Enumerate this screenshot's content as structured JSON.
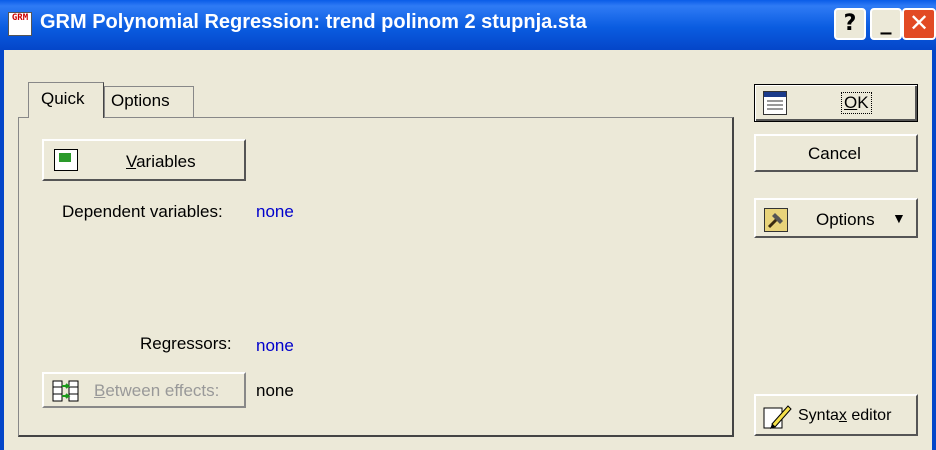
{
  "window": {
    "title": "GRM Polynomial Regression: trend polinom 2 stupnja.sta",
    "app_icon_text": "GRM",
    "help_glyph": "?",
    "minimize_glyph": "_",
    "close_glyph": "✕"
  },
  "tabs": [
    {
      "label": "Quick",
      "active": true
    },
    {
      "label": "Options",
      "active": false
    }
  ],
  "quick": {
    "variables_button": {
      "mnemonic": "V",
      "rest": "ariables"
    },
    "dependent_label": "Dependent variables:",
    "dependent_value": "none",
    "regressors_label": "Regressors:",
    "regressors_value": "none",
    "between_button": {
      "mnemonic": "B",
      "rest": "etween effects:",
      "enabled": false
    },
    "between_value": "none"
  },
  "side_buttons": {
    "ok": {
      "mnemonic": "O",
      "rest": "K"
    },
    "cancel": "Cancel",
    "options": "Options",
    "options_arrow": "▼",
    "syntax": {
      "before": "Synta",
      "mnemonic": "x",
      "after": " editor"
    }
  },
  "colors": {
    "titlebar": "#0a5ce0",
    "value_text": "#0000cc",
    "dialog_bg": "#ece9d8"
  }
}
